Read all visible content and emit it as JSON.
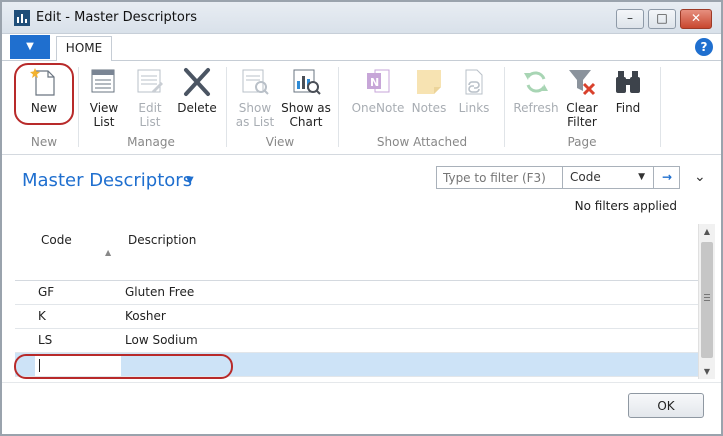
{
  "window": {
    "title": "Edit - Master Descriptors",
    "controls": {
      "minimize": "–",
      "maximize": "□",
      "close": "✕"
    }
  },
  "ribbon": {
    "file_glyph": "▼",
    "tab": "HOME",
    "help": "?",
    "groups": {
      "new": {
        "label": "New",
        "buttons": {
          "new": "New"
        }
      },
      "manage": {
        "label": "Manage",
        "buttons": {
          "view_list": [
            "View",
            "List"
          ],
          "edit_list": [
            "Edit",
            "List"
          ],
          "delete": "Delete"
        }
      },
      "view": {
        "label": "View",
        "buttons": {
          "show_as_list": [
            "Show",
            "as List"
          ],
          "show_as_chart": [
            "Show as",
            "Chart"
          ]
        }
      },
      "show_attached": {
        "label": "Show Attached",
        "buttons": {
          "onenote": "OneNote",
          "notes": "Notes",
          "links": "Links"
        }
      },
      "page": {
        "label": "Page",
        "buttons": {
          "refresh": "Refresh",
          "clear_filter": [
            "Clear",
            "Filter"
          ],
          "find": "Find"
        }
      }
    }
  },
  "page": {
    "title": "Master Descriptors",
    "filter": {
      "placeholder": "Type to filter (F3)",
      "field": "Code"
    },
    "filter_status": "No filters applied"
  },
  "table": {
    "columns": {
      "code": "Code",
      "description": "Description"
    },
    "rows": [
      {
        "code": "GF",
        "description": "Gluten Free"
      },
      {
        "code": "K",
        "description": "Kosher"
      },
      {
        "code": "LS",
        "description": "Low Sodium"
      }
    ]
  },
  "footer": {
    "ok": "OK"
  },
  "colors": {
    "accent": "#1f6fcf",
    "highlight": "#b82a2a",
    "selected_row": "#cde3f7"
  }
}
